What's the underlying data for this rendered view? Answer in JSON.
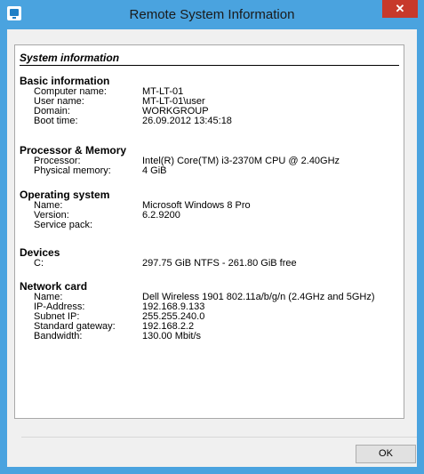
{
  "window": {
    "title": "Remote System Information",
    "close_glyph": "✕"
  },
  "report": {
    "title": "System information",
    "sections": [
      {
        "heading": "Basic information",
        "rows": [
          {
            "label": "Computer name:",
            "value": "MT-LT-01"
          },
          {
            "label": "User name:",
            "value": "MT-LT-01\\user"
          },
          {
            "label": "Domain:",
            "value": "WORKGROUP"
          },
          {
            "label": "Boot time:",
            "value": "26.09.2012 13:45:18"
          }
        ]
      },
      {
        "heading": "Processor & Memory",
        "rows": [
          {
            "label": "Processor:",
            "value": "Intel(R) Core(TM) i3-2370M CPU @ 2.40GHz"
          },
          {
            "label": "Physical memory:",
            "value": "4 GiB"
          }
        ]
      },
      {
        "heading": "Operating system",
        "rows": [
          {
            "label": "Name:",
            "value": "Microsoft Windows 8 Pro"
          },
          {
            "label": "Version:",
            "value": "6.2.9200"
          },
          {
            "label": "Service pack:",
            "value": ""
          }
        ]
      },
      {
        "heading": "Devices",
        "rows": [
          {
            "label": "C:",
            "value": "297.75 GiB NTFS - 261.80 GiB free"
          }
        ]
      },
      {
        "heading": "Network card",
        "rows": [
          {
            "label": "Name:",
            "value": "Dell Wireless 1901 802.11a/b/g/n (2.4GHz and 5GHz)"
          },
          {
            "label": "IP-Address:",
            "value": "192.168.9.133"
          },
          {
            "label": "Subnet IP:",
            "value": "255.255.240.0"
          },
          {
            "label": "Standard gateway:",
            "value": "192.168.2.2"
          },
          {
            "label": "Bandwidth:",
            "value": "130.00 Mbit/s"
          }
        ]
      }
    ]
  },
  "buttons": {
    "ok": "OK"
  },
  "colors": {
    "frame": "#4aa3df",
    "close": "#c7392b"
  },
  "icons": {
    "app": "monitor-icon",
    "close": "close-icon"
  }
}
